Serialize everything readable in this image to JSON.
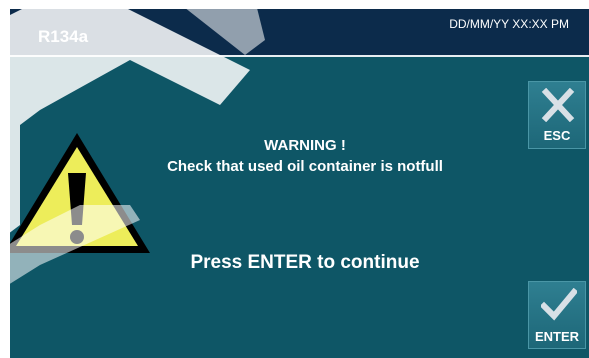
{
  "header": {
    "refrigerant": "R134a",
    "datetime": "DD/MM/YY XX:XX PM"
  },
  "dialog": {
    "title": "WARNING !",
    "message": "Check that used oil container is notfull",
    "instruction": "Press ENTER to continue"
  },
  "buttons": {
    "esc_label": "ESC",
    "enter_label": "ENTER"
  },
  "icons": {
    "warning": "warning-triangle-icon",
    "esc": "close-x-icon",
    "enter": "checkmark-icon"
  },
  "colors": {
    "header_bg": "#0c2b4b",
    "screen_bg": "#0e5666",
    "warning_fill": "#eded5a",
    "text": "#ffffff"
  }
}
